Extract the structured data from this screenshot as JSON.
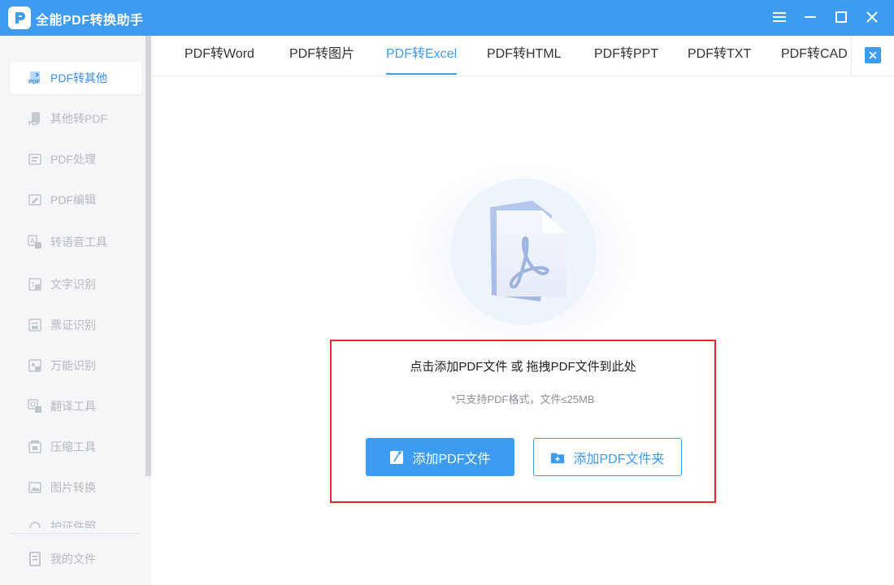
{
  "app": {
    "title": "全能PDF转换助手"
  },
  "colors": {
    "primary": "#3d9bf0",
    "highlight_border": "#e8272b"
  },
  "sidebar": {
    "items": [
      {
        "label": "PDF转其他",
        "icon": "pdf-convert-icon",
        "active": true
      },
      {
        "label": "其他转PDF",
        "icon": "to-pdf-icon"
      },
      {
        "label": "PDF处理",
        "icon": "pdf-process-icon"
      },
      {
        "label": "PDF编辑",
        "icon": "pdf-edit-icon"
      },
      {
        "label": "转语音工具",
        "icon": "text-to-speech-icon"
      },
      {
        "label": "文字识别",
        "icon": "ocr-icon"
      },
      {
        "label": "票证识别",
        "icon": "ticket-recognition-icon"
      },
      {
        "label": "万能识别",
        "icon": "universal-recognition-icon"
      },
      {
        "label": "翻译工具",
        "icon": "translate-icon"
      },
      {
        "label": "压缩工具",
        "icon": "compress-icon"
      },
      {
        "label": "图片转换",
        "icon": "image-convert-icon"
      },
      {
        "label": "护证件照",
        "icon": "id-photo-icon"
      }
    ],
    "my_files": "我的文件"
  },
  "tabs": [
    {
      "label": "PDF转Word"
    },
    {
      "label": "PDF转图片"
    },
    {
      "label": "PDF转Excel",
      "active": true
    },
    {
      "label": "PDF转HTML"
    },
    {
      "label": "PDF转PPT"
    },
    {
      "label": "PDF转TXT"
    },
    {
      "label": "PDF转CAD"
    }
  ],
  "upload": {
    "hint": "点击添加PDF文件 或 拖拽PDF文件到此处",
    "note": "*只支持PDF格式，文件≤25MB",
    "add_file_label": "添加PDF文件",
    "add_folder_label": "添加PDF文件夹"
  }
}
